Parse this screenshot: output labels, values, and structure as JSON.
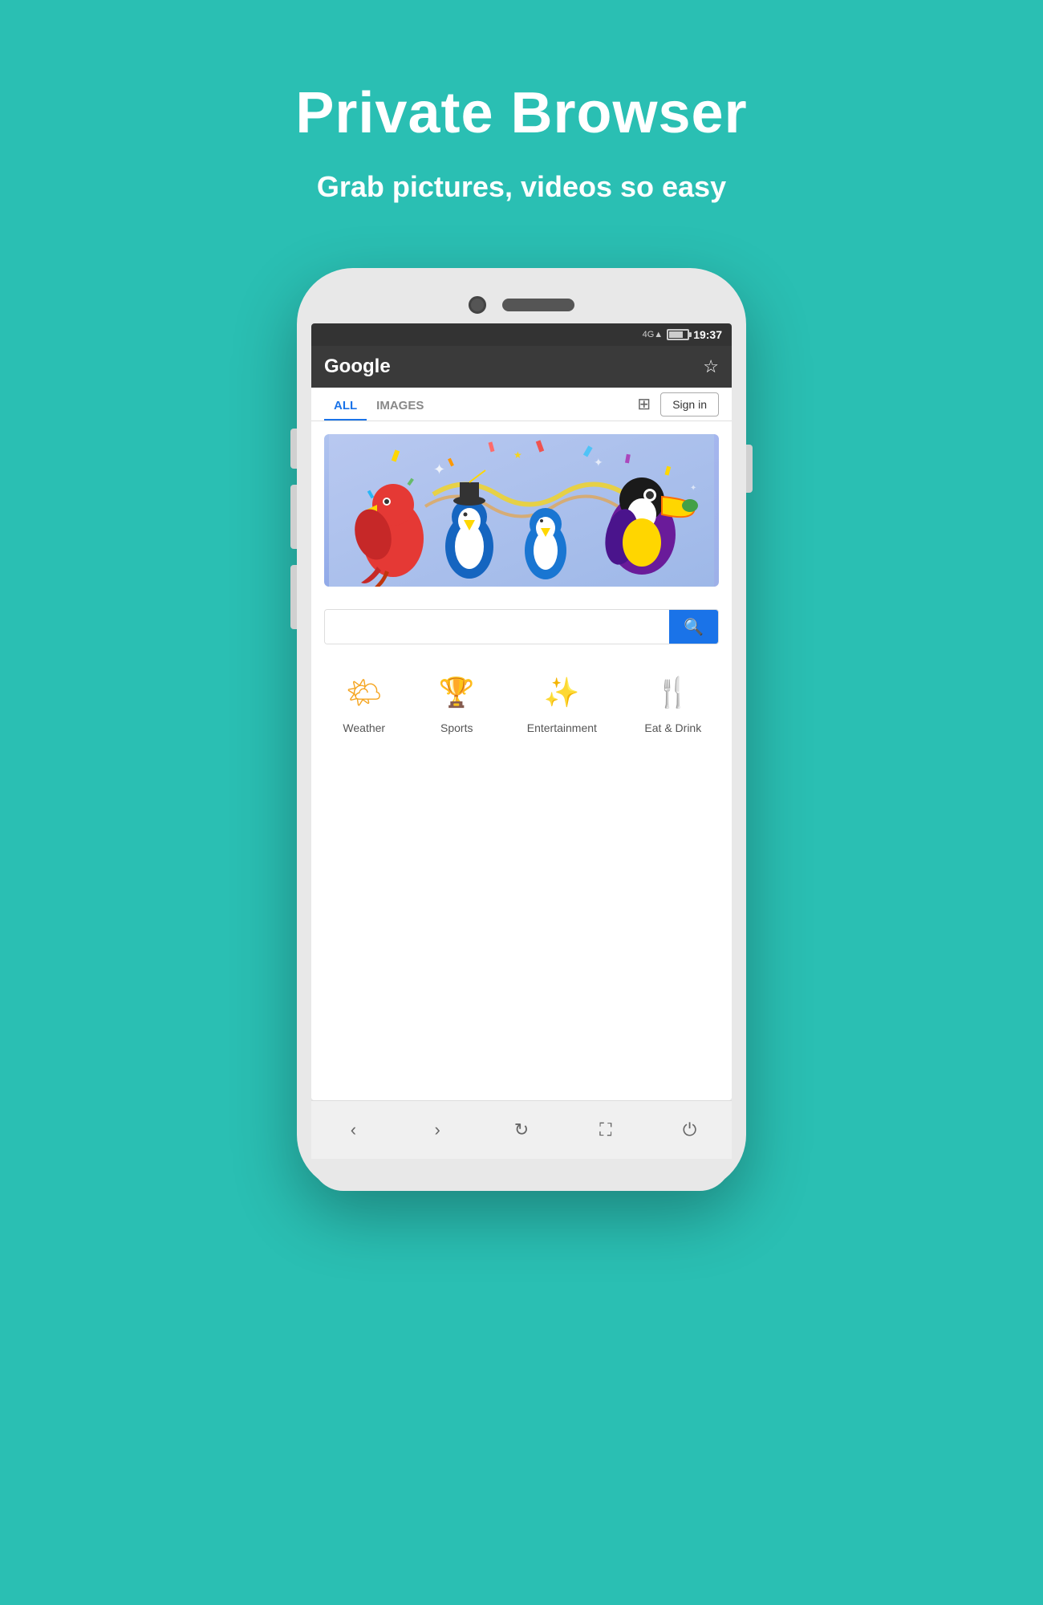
{
  "header": {
    "title": "Private Browser",
    "subtitle": "Grab pictures, videos so easy"
  },
  "status_bar": {
    "time": "19:37",
    "signal": "4G",
    "battery_level": 70
  },
  "browser": {
    "title": "Google",
    "tabs": [
      {
        "label": "ALL",
        "active": true
      },
      {
        "label": "IMAGES",
        "active": false
      }
    ],
    "signin_label": "Sign in"
  },
  "search": {
    "placeholder": "",
    "button_label": "🔍"
  },
  "quick_links": [
    {
      "label": "Weather",
      "icon": "weather"
    },
    {
      "label": "Sports",
      "icon": "sports"
    },
    {
      "label": "Entertainment",
      "icon": "entertainment"
    },
    {
      "label": "Eat & Drink",
      "icon": "food"
    }
  ],
  "nav": {
    "back": "‹",
    "forward": "›",
    "refresh": "↻",
    "fullscreen": "⛶",
    "power": "⏻"
  }
}
